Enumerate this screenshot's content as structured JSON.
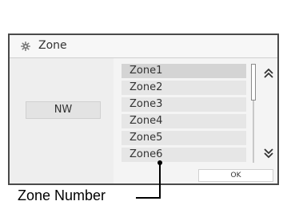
{
  "dialog": {
    "title": "Zone",
    "title_icon": "gear-icon",
    "left_value": "NW",
    "ok_label": "OK"
  },
  "list": {
    "items": [
      "Zone1",
      "Zone2",
      "Zone3",
      "Zone4",
      "Zone5",
      "Zone6"
    ],
    "selected_index": 0
  },
  "scroll": {
    "up_icon": "chevron-double-up-icon",
    "down_icon": "chevron-double-down-icon"
  },
  "callout": {
    "label": "Zone Number"
  }
}
